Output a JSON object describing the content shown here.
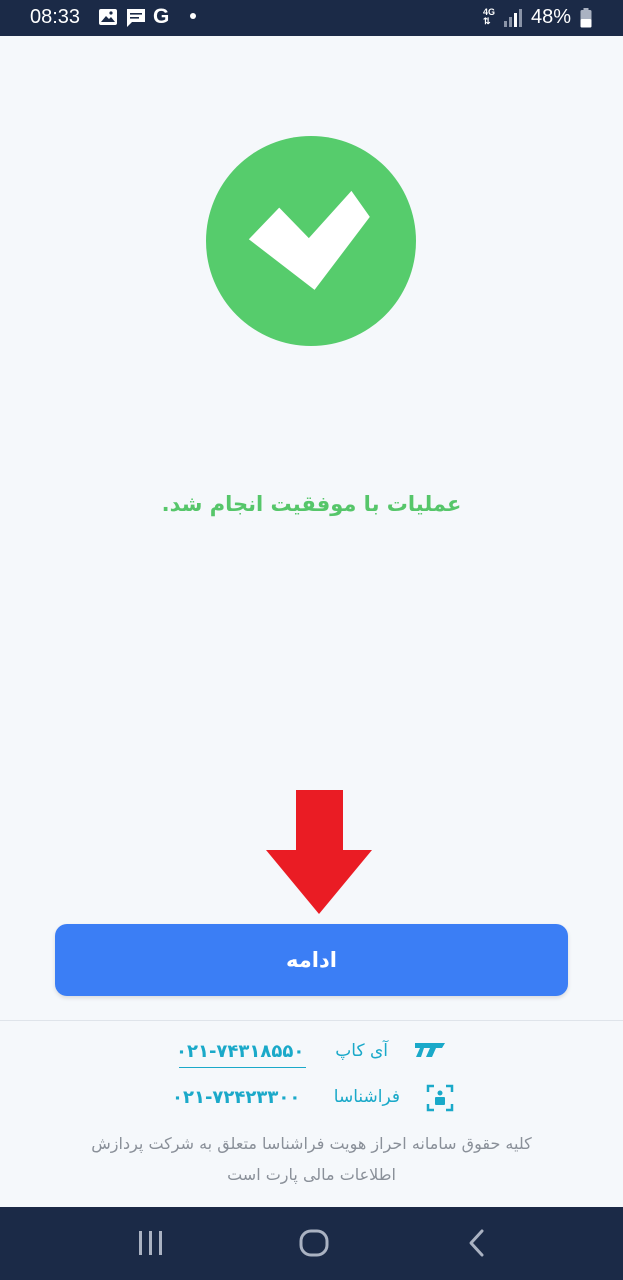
{
  "status_bar": {
    "time": "08:33",
    "network": "4G",
    "battery": "48%",
    "icons": [
      "image-icon",
      "message-icon",
      "google-icon",
      "notification-dot",
      "wifi-icon",
      "signal-icon",
      "battery-icon"
    ],
    "g_letter": "G"
  },
  "main": {
    "success_icon": "check-circle-icon",
    "success_color": "#56c66a",
    "message": "عملیات با موفقیت انجام شد.",
    "arrow_icon": "down-arrow-icon",
    "arrow_color": "#ea1c24"
  },
  "continue_button": {
    "label": "ادامه",
    "color": "#3b7ef5"
  },
  "contacts": [
    {
      "name": "آی کاپ",
      "phone": "۰۲۱-۷۴۳۱۸۵۵۰",
      "icon": "icap-logo-icon"
    },
    {
      "name": "فراشناسا",
      "phone": "۰۲۱-۷۲۴۲۳۳۰۰",
      "icon": "farashenasa-logo-icon"
    }
  ],
  "footer": {
    "line1": "کلیه حقوق سامانه احراز هویت فراشناسا متعلق به شرکت پردازش",
    "line2": "اطلاعات مالی پارت است"
  },
  "nav_bar": {
    "items": [
      "recent-apps-icon",
      "home-icon",
      "back-icon"
    ]
  }
}
